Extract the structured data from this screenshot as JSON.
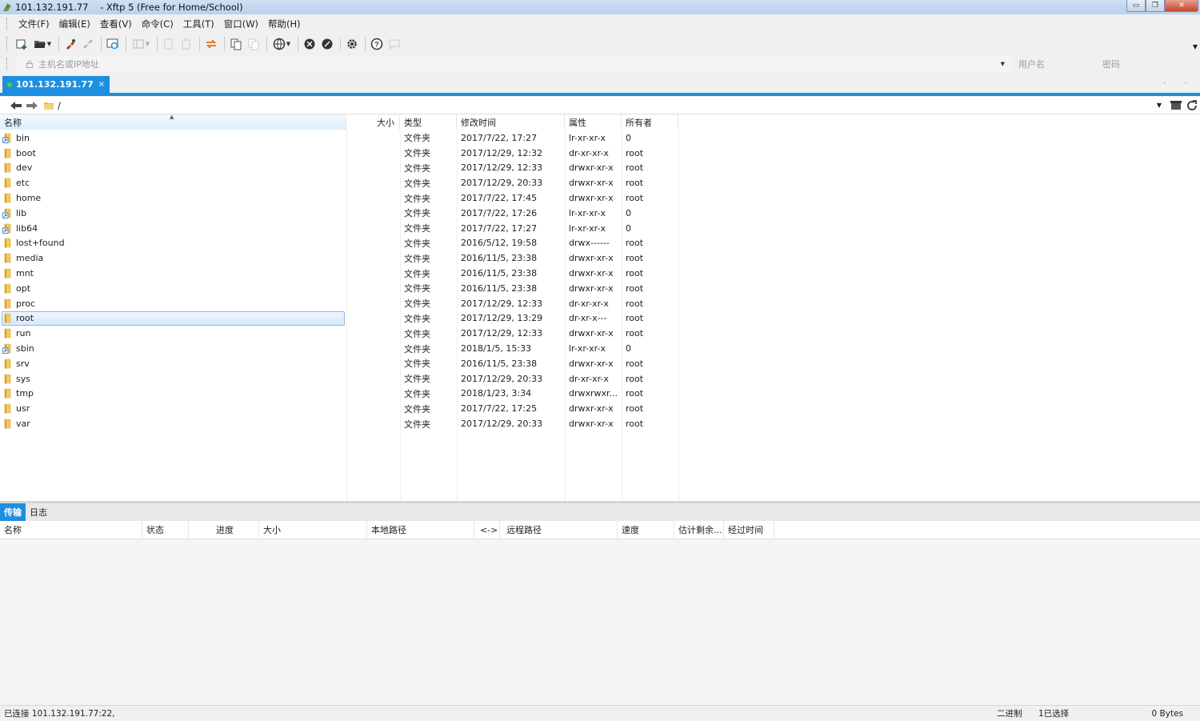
{
  "window": {
    "title": "101.132.191.77    - Xftp 5 (Free for Home/School)",
    "minimize": "▭",
    "restore": "❐",
    "close": "✕"
  },
  "menu": [
    "文件(F)",
    "编辑(E)",
    "查看(V)",
    "命令(C)",
    "工具(T)",
    "窗口(W)",
    "帮助(H)"
  ],
  "address": {
    "host_placeholder": "主机名或IP地址",
    "user_placeholder": "用户名",
    "pass_placeholder": "密码"
  },
  "session_tab": {
    "label": "101.132.191.77",
    "close": "×"
  },
  "path": {
    "current": "/"
  },
  "file_list": {
    "columns": {
      "name": "名称",
      "size": "大小",
      "type": "类型",
      "mtime": "修改时间",
      "attr": "属性",
      "owner": "所有者"
    },
    "rows": [
      {
        "name": "bin",
        "type": "文件夹",
        "mtime": "2017/7/22, 17:27",
        "attr": "lr-xr-xr-x",
        "owner": "0",
        "link": true
      },
      {
        "name": "boot",
        "type": "文件夹",
        "mtime": "2017/12/29, 12:32",
        "attr": "dr-xr-xr-x",
        "owner": "root",
        "link": false
      },
      {
        "name": "dev",
        "type": "文件夹",
        "mtime": "2017/12/29, 12:33",
        "attr": "drwxr-xr-x",
        "owner": "root",
        "link": false
      },
      {
        "name": "etc",
        "type": "文件夹",
        "mtime": "2017/12/29, 20:33",
        "attr": "drwxr-xr-x",
        "owner": "root",
        "link": false
      },
      {
        "name": "home",
        "type": "文件夹",
        "mtime": "2017/7/22, 17:45",
        "attr": "drwxr-xr-x",
        "owner": "root",
        "link": false
      },
      {
        "name": "lib",
        "type": "文件夹",
        "mtime": "2017/7/22, 17:26",
        "attr": "lr-xr-xr-x",
        "owner": "0",
        "link": true
      },
      {
        "name": "lib64",
        "type": "文件夹",
        "mtime": "2017/7/22, 17:27",
        "attr": "lr-xr-xr-x",
        "owner": "0",
        "link": true
      },
      {
        "name": "lost+found",
        "type": "文件夹",
        "mtime": "2016/5/12, 19:58",
        "attr": "drwx------",
        "owner": "root",
        "link": false
      },
      {
        "name": "media",
        "type": "文件夹",
        "mtime": "2016/11/5, 23:38",
        "attr": "drwxr-xr-x",
        "owner": "root",
        "link": false
      },
      {
        "name": "mnt",
        "type": "文件夹",
        "mtime": "2016/11/5, 23:38",
        "attr": "drwxr-xr-x",
        "owner": "root",
        "link": false
      },
      {
        "name": "opt",
        "type": "文件夹",
        "mtime": "2016/11/5, 23:38",
        "attr": "drwxr-xr-x",
        "owner": "root",
        "link": false
      },
      {
        "name": "proc",
        "type": "文件夹",
        "mtime": "2017/12/29, 12:33",
        "attr": "dr-xr-xr-x",
        "owner": "root",
        "link": false
      },
      {
        "name": "root",
        "type": "文件夹",
        "mtime": "2017/12/29, 13:29",
        "attr": "dr-xr-x---",
        "owner": "root",
        "link": false,
        "selected": true
      },
      {
        "name": "run",
        "type": "文件夹",
        "mtime": "2017/12/29, 12:33",
        "attr": "drwxr-xr-x",
        "owner": "root",
        "link": false
      },
      {
        "name": "sbin",
        "type": "文件夹",
        "mtime": "2018/1/5, 15:33",
        "attr": "lr-xr-xr-x",
        "owner": "0",
        "link": true
      },
      {
        "name": "srv",
        "type": "文件夹",
        "mtime": "2016/11/5, 23:38",
        "attr": "drwxr-xr-x",
        "owner": "root",
        "link": false
      },
      {
        "name": "sys",
        "type": "文件夹",
        "mtime": "2017/12/29, 20:33",
        "attr": "dr-xr-xr-x",
        "owner": "root",
        "link": false
      },
      {
        "name": "tmp",
        "type": "文件夹",
        "mtime": "2018/1/23, 3:34",
        "attr": "drwxrwxr...",
        "owner": "root",
        "link": false
      },
      {
        "name": "usr",
        "type": "文件夹",
        "mtime": "2017/7/22, 17:25",
        "attr": "drwxr-xr-x",
        "owner": "root",
        "link": false
      },
      {
        "name": "var",
        "type": "文件夹",
        "mtime": "2017/12/29, 20:33",
        "attr": "drwxr-xr-x",
        "owner": "root",
        "link": false
      }
    ]
  },
  "transfer": {
    "tabs": [
      "传输",
      "日志"
    ],
    "columns": [
      "名称",
      "状态",
      "进度",
      "大小",
      "本地路径",
      "<->",
      "远程路径",
      "速度",
      "估计剩余...",
      "经过时间"
    ]
  },
  "status": {
    "connection": "已连接 101.132.191.77:22,",
    "mode": "二进制",
    "selection": "1已选择",
    "bytes": "0 Bytes"
  },
  "colors": {
    "accent": "#1e8fe0",
    "folder": "#e8b84a",
    "selection_border": "#8fb7e3"
  }
}
